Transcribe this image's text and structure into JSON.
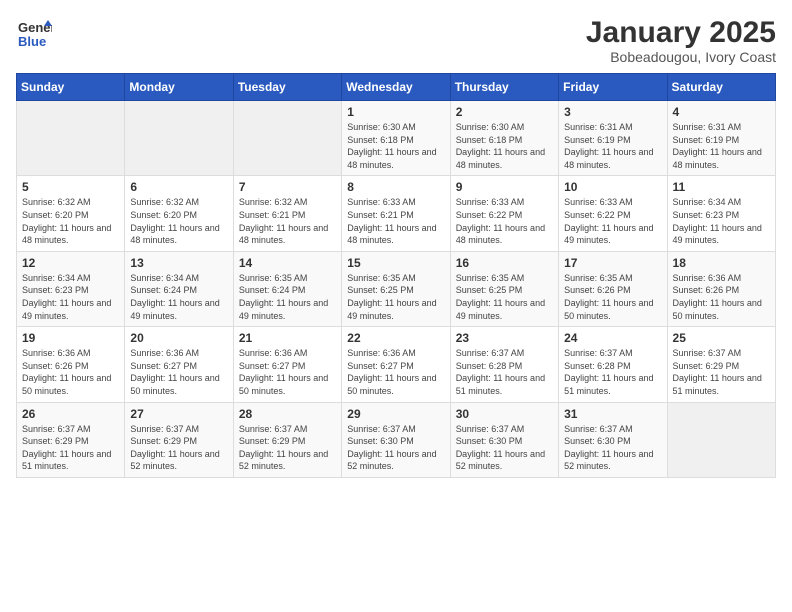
{
  "header": {
    "logo": {
      "general": "General",
      "blue": "Blue"
    },
    "title": "January 2025",
    "subtitle": "Bobeadougou, Ivory Coast"
  },
  "weekdays": [
    "Sunday",
    "Monday",
    "Tuesday",
    "Wednesday",
    "Thursday",
    "Friday",
    "Saturday"
  ],
  "weeks": [
    [
      {
        "day": "",
        "info": ""
      },
      {
        "day": "",
        "info": ""
      },
      {
        "day": "",
        "info": ""
      },
      {
        "day": "1",
        "info": "Sunrise: 6:30 AM\nSunset: 6:18 PM\nDaylight: 11 hours and 48 minutes."
      },
      {
        "day": "2",
        "info": "Sunrise: 6:30 AM\nSunset: 6:18 PM\nDaylight: 11 hours and 48 minutes."
      },
      {
        "day": "3",
        "info": "Sunrise: 6:31 AM\nSunset: 6:19 PM\nDaylight: 11 hours and 48 minutes."
      },
      {
        "day": "4",
        "info": "Sunrise: 6:31 AM\nSunset: 6:19 PM\nDaylight: 11 hours and 48 minutes."
      }
    ],
    [
      {
        "day": "5",
        "info": "Sunrise: 6:32 AM\nSunset: 6:20 PM\nDaylight: 11 hours and 48 minutes."
      },
      {
        "day": "6",
        "info": "Sunrise: 6:32 AM\nSunset: 6:20 PM\nDaylight: 11 hours and 48 minutes."
      },
      {
        "day": "7",
        "info": "Sunrise: 6:32 AM\nSunset: 6:21 PM\nDaylight: 11 hours and 48 minutes."
      },
      {
        "day": "8",
        "info": "Sunrise: 6:33 AM\nSunset: 6:21 PM\nDaylight: 11 hours and 48 minutes."
      },
      {
        "day": "9",
        "info": "Sunrise: 6:33 AM\nSunset: 6:22 PM\nDaylight: 11 hours and 48 minutes."
      },
      {
        "day": "10",
        "info": "Sunrise: 6:33 AM\nSunset: 6:22 PM\nDaylight: 11 hours and 49 minutes."
      },
      {
        "day": "11",
        "info": "Sunrise: 6:34 AM\nSunset: 6:23 PM\nDaylight: 11 hours and 49 minutes."
      }
    ],
    [
      {
        "day": "12",
        "info": "Sunrise: 6:34 AM\nSunset: 6:23 PM\nDaylight: 11 hours and 49 minutes."
      },
      {
        "day": "13",
        "info": "Sunrise: 6:34 AM\nSunset: 6:24 PM\nDaylight: 11 hours and 49 minutes."
      },
      {
        "day": "14",
        "info": "Sunrise: 6:35 AM\nSunset: 6:24 PM\nDaylight: 11 hours and 49 minutes."
      },
      {
        "day": "15",
        "info": "Sunrise: 6:35 AM\nSunset: 6:25 PM\nDaylight: 11 hours and 49 minutes."
      },
      {
        "day": "16",
        "info": "Sunrise: 6:35 AM\nSunset: 6:25 PM\nDaylight: 11 hours and 49 minutes."
      },
      {
        "day": "17",
        "info": "Sunrise: 6:35 AM\nSunset: 6:26 PM\nDaylight: 11 hours and 50 minutes."
      },
      {
        "day": "18",
        "info": "Sunrise: 6:36 AM\nSunset: 6:26 PM\nDaylight: 11 hours and 50 minutes."
      }
    ],
    [
      {
        "day": "19",
        "info": "Sunrise: 6:36 AM\nSunset: 6:26 PM\nDaylight: 11 hours and 50 minutes."
      },
      {
        "day": "20",
        "info": "Sunrise: 6:36 AM\nSunset: 6:27 PM\nDaylight: 11 hours and 50 minutes."
      },
      {
        "day": "21",
        "info": "Sunrise: 6:36 AM\nSunset: 6:27 PM\nDaylight: 11 hours and 50 minutes."
      },
      {
        "day": "22",
        "info": "Sunrise: 6:36 AM\nSunset: 6:27 PM\nDaylight: 11 hours and 50 minutes."
      },
      {
        "day": "23",
        "info": "Sunrise: 6:37 AM\nSunset: 6:28 PM\nDaylight: 11 hours and 51 minutes."
      },
      {
        "day": "24",
        "info": "Sunrise: 6:37 AM\nSunset: 6:28 PM\nDaylight: 11 hours and 51 minutes."
      },
      {
        "day": "25",
        "info": "Sunrise: 6:37 AM\nSunset: 6:29 PM\nDaylight: 11 hours and 51 minutes."
      }
    ],
    [
      {
        "day": "26",
        "info": "Sunrise: 6:37 AM\nSunset: 6:29 PM\nDaylight: 11 hours and 51 minutes."
      },
      {
        "day": "27",
        "info": "Sunrise: 6:37 AM\nSunset: 6:29 PM\nDaylight: 11 hours and 52 minutes."
      },
      {
        "day": "28",
        "info": "Sunrise: 6:37 AM\nSunset: 6:29 PM\nDaylight: 11 hours and 52 minutes."
      },
      {
        "day": "29",
        "info": "Sunrise: 6:37 AM\nSunset: 6:30 PM\nDaylight: 11 hours and 52 minutes."
      },
      {
        "day": "30",
        "info": "Sunrise: 6:37 AM\nSunset: 6:30 PM\nDaylight: 11 hours and 52 minutes."
      },
      {
        "day": "31",
        "info": "Sunrise: 6:37 AM\nSunset: 6:30 PM\nDaylight: 11 hours and 52 minutes."
      },
      {
        "day": "",
        "info": ""
      }
    ]
  ]
}
